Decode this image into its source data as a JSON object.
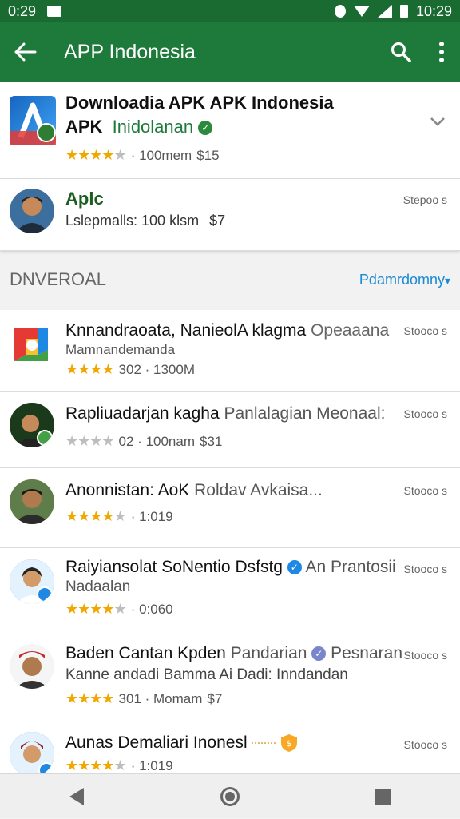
{
  "status_bar": {
    "time_left": "0:29",
    "time_right": "10:29"
  },
  "header": {
    "title": "APP Indonesia"
  },
  "featured": {
    "title": "Downloadia APK APK Indonesia",
    "subtitle_bold": "APK",
    "subtitle_green": "Inidolanan",
    "rating_stars": 4,
    "meta_text": "· 100mem",
    "price": "$15"
  },
  "second": {
    "title": "Aplc",
    "subtitle": "Lslepmalls: 100 klsm",
    "price": "$7",
    "right_label": "Stepoo s"
  },
  "section": {
    "title": "DNVEROAL",
    "link": "Pdamrdomny"
  },
  "list": [
    {
      "title": "Knnandraoata, NanieolA klagma",
      "title_gray": "Opeaaana",
      "sub": "Mamnandemanda",
      "rating_stars": 4,
      "meta": "302 · 1300M",
      "right": "Stooco s"
    },
    {
      "title": "Rapliuadarjan kagha",
      "title_gray": "Panlalagian Meonaal:",
      "sub": "",
      "rating_stars": 4,
      "meta": "02 · 100nam",
      "price": "$31",
      "right": "Stooco s"
    },
    {
      "title": "Anonnistan: AoK",
      "title_gray": "Roldav Avkaisa...",
      "sub": "",
      "rating_stars": 4,
      "meta": "· 1:019",
      "right": "Stooco s"
    },
    {
      "title": "Raiyiansolat SoNentio Dsfstg",
      "title_gray": "An Prantosii",
      "sub": "Nadaalan",
      "rating_stars": 4,
      "meta": "· 0:060",
      "right": "Stooco s"
    },
    {
      "title": "Baden Cantan Kpden",
      "title_gray": "Pandarian",
      "title_gray2": "Pesnaran",
      "sub": "Kanne andadi Bamma Ai Dadi: Inndandan",
      "rating_stars": 4,
      "meta": "301 · Momam",
      "price": "$7",
      "right": "Stooco s"
    },
    {
      "title": "Aunas Demaliari Inonesl",
      "sub": "",
      "rating_stars": 4,
      "meta": "· 1:019",
      "right": "Stooco s"
    }
  ]
}
